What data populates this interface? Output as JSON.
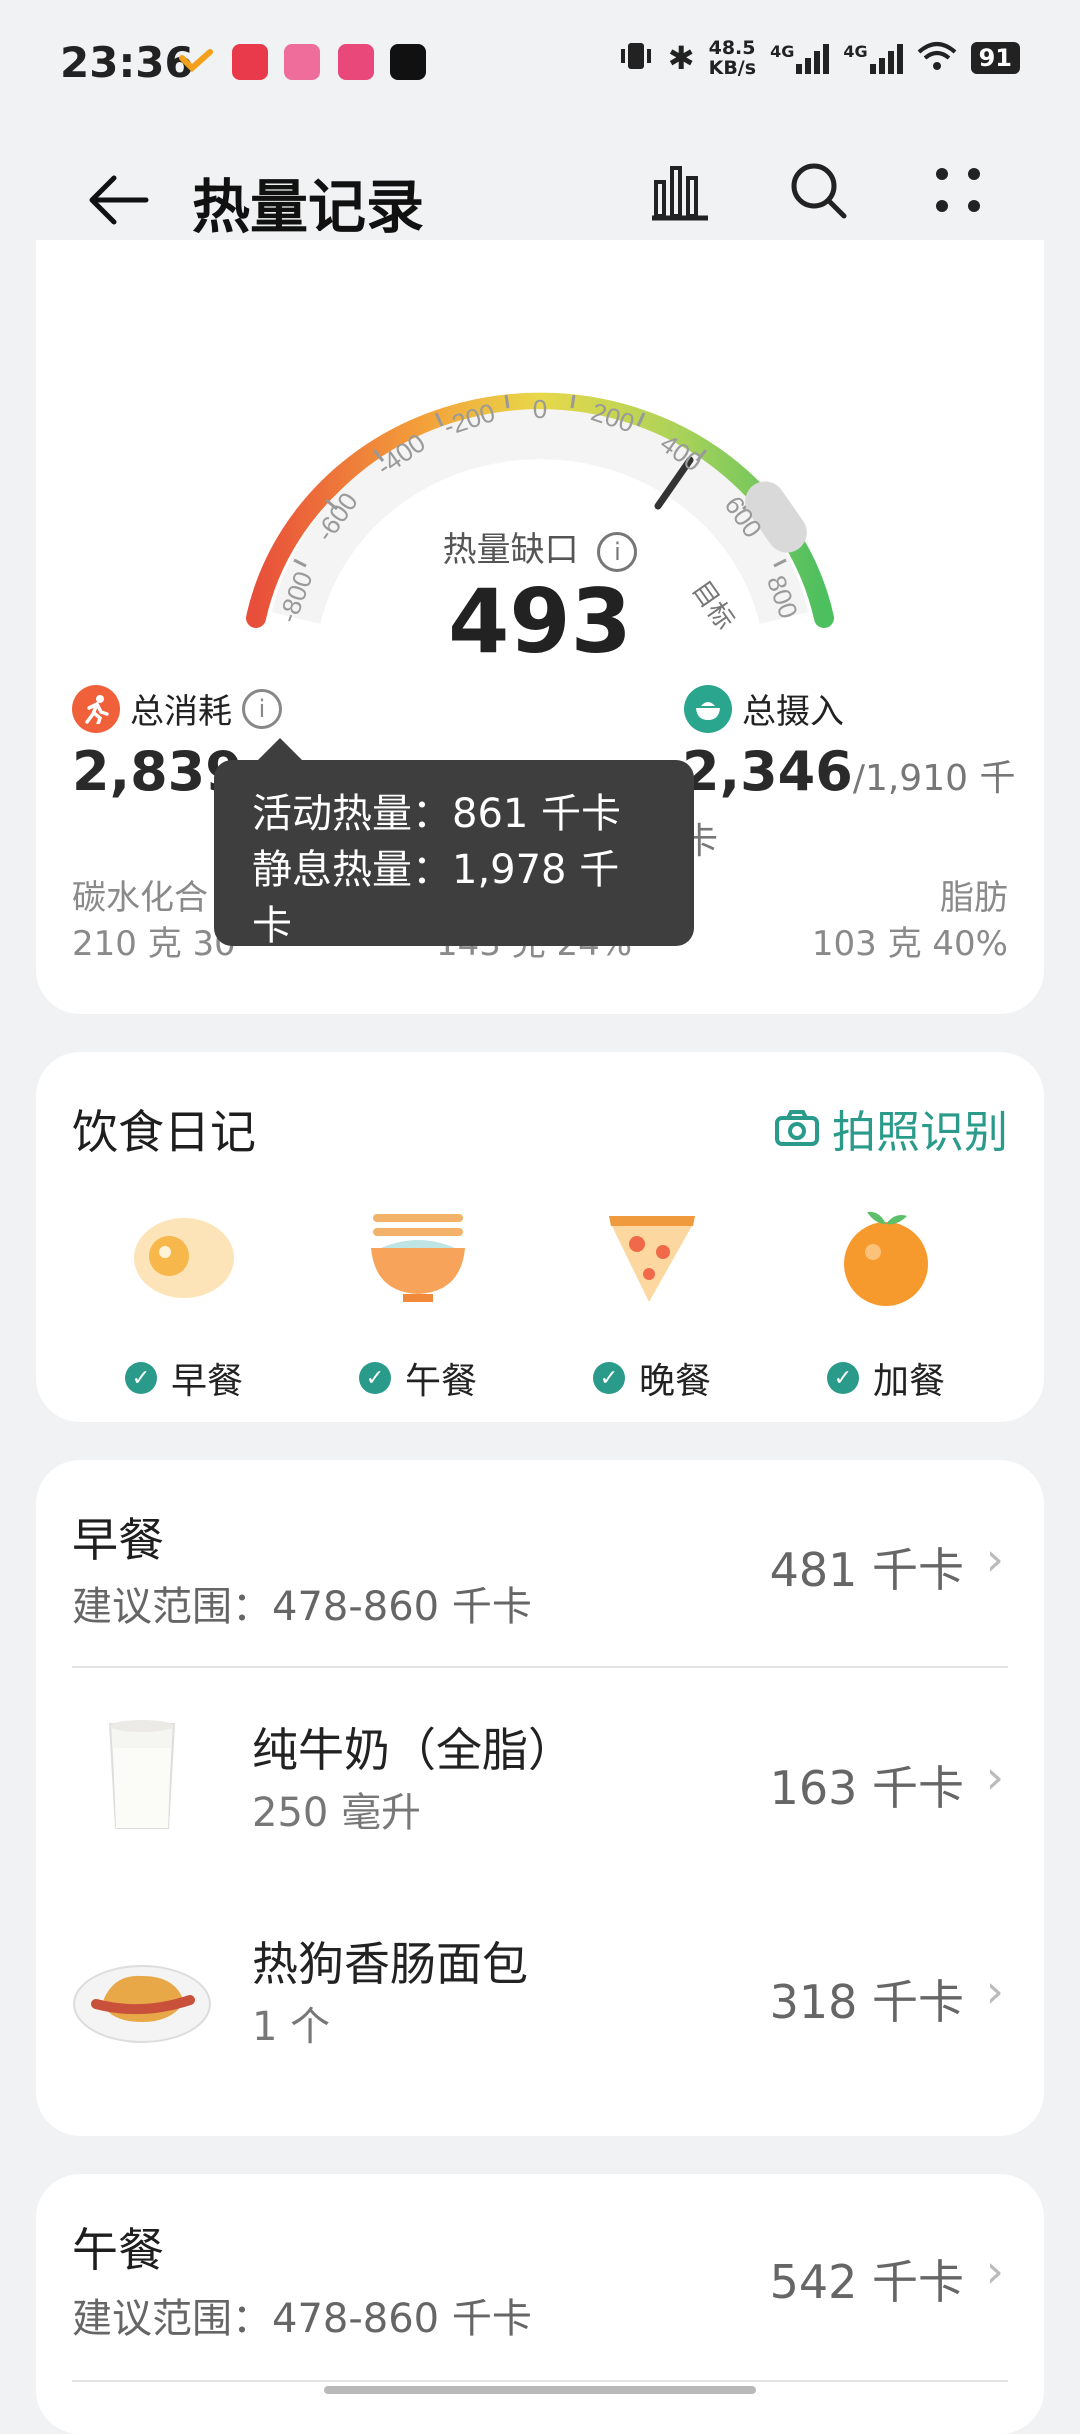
{
  "status_bar": {
    "time": "23:36",
    "net_speed_top": "48.5",
    "net_speed_bottom": "KB/s",
    "net_badge_1": "4G",
    "net_badge_2": "4G",
    "battery": "91"
  },
  "header": {
    "title": "热量记录",
    "back_icon": "arrow-left-icon",
    "chart_icon": "bar-chart-icon",
    "search_icon": "search-icon",
    "more_icon": "more-dots-icon"
  },
  "summary": {
    "gauge_ticks": [
      "-800",
      "-600",
      "-400",
      "-200",
      "0",
      "200",
      "400",
      "600",
      "800"
    ],
    "target_label": "目标",
    "deficit_label": "热量缺口",
    "deficit_value": "493",
    "burn_label": "总消耗",
    "burn_value": "2,839",
    "intake_label": "总摄入",
    "intake_value": "2,346",
    "intake_target": "/1,910 千卡",
    "carb_label": "碳水化合",
    "carb_value": "210 克  30",
    "protein_value": "143 克  24%",
    "fat_label": "脂肪",
    "fat_value": "103 克  40%",
    "tooltip_line1": "活动热量：861 千卡",
    "tooltip_line2": "静息热量：1,978 千卡"
  },
  "diary": {
    "title": "饮食日记",
    "photo_label": "拍照识别",
    "meals": [
      {
        "label": "早餐",
        "icon": "fried-egg-icon"
      },
      {
        "label": "午餐",
        "icon": "noodle-bowl-icon"
      },
      {
        "label": "晚餐",
        "icon": "pizza-slice-icon"
      },
      {
        "label": "加餐",
        "icon": "orange-icon"
      }
    ]
  },
  "breakfast": {
    "title": "早餐",
    "range": "建议范围：478-860 千卡",
    "kcal": "481 千卡",
    "items": [
      {
        "name": "纯牛奶（全脂）",
        "amount": "250 毫升",
        "kcal": "163 千卡",
        "icon": "milk-glass-icon"
      },
      {
        "name": "热狗香肠面包",
        "amount": "1 个",
        "kcal": "318 千卡",
        "icon": "hotdog-bread-icon"
      }
    ]
  },
  "lunch": {
    "title": "午餐",
    "range": "建议范围：478-860 千卡",
    "kcal": "542 千卡"
  }
}
